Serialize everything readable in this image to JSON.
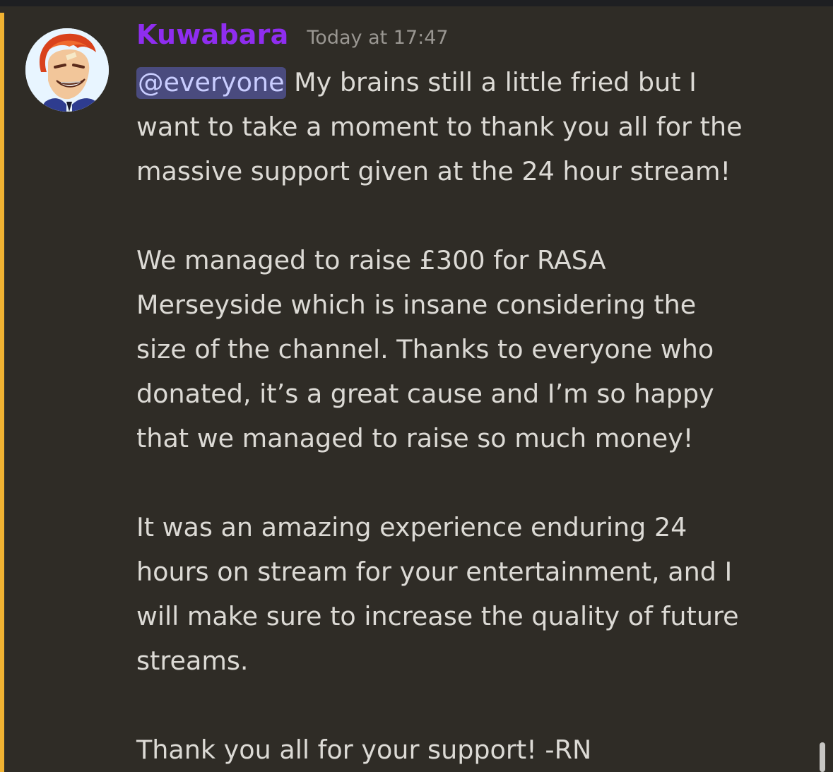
{
  "message": {
    "author": "Kuwabara",
    "timestamp": "Today at 17:47",
    "mention": "@everyone",
    "lines": {
      "l1_rest": " My brains still a little fried but I",
      "l2": "want to take a moment to thank you all for the",
      "l3": "massive support given at the 24 hour stream!",
      "l5": "We managed to raise £300 for RASA",
      "l6": "Merseyside which is insane considering the",
      "l7": "size of the channel. Thanks to everyone who",
      "l8": "donated, it’s a great cause and I’m so happy",
      "l9": "that we managed to raise so much money!",
      "l11": "It was an amazing experience enduring 24",
      "l12": "hours on stream for your entertainment, and I",
      "l13": "will make sure to increase the quality of future",
      "l14": "streams.",
      "l16": "Thank you all for your support! -RN"
    }
  },
  "colors": {
    "background": "#2f2c26",
    "highlight_bar": "#f0b232",
    "username": "#8f2df0",
    "mention_bg": "#4a4b7e"
  },
  "icons": {
    "avatar": "anime-character-avatar"
  }
}
